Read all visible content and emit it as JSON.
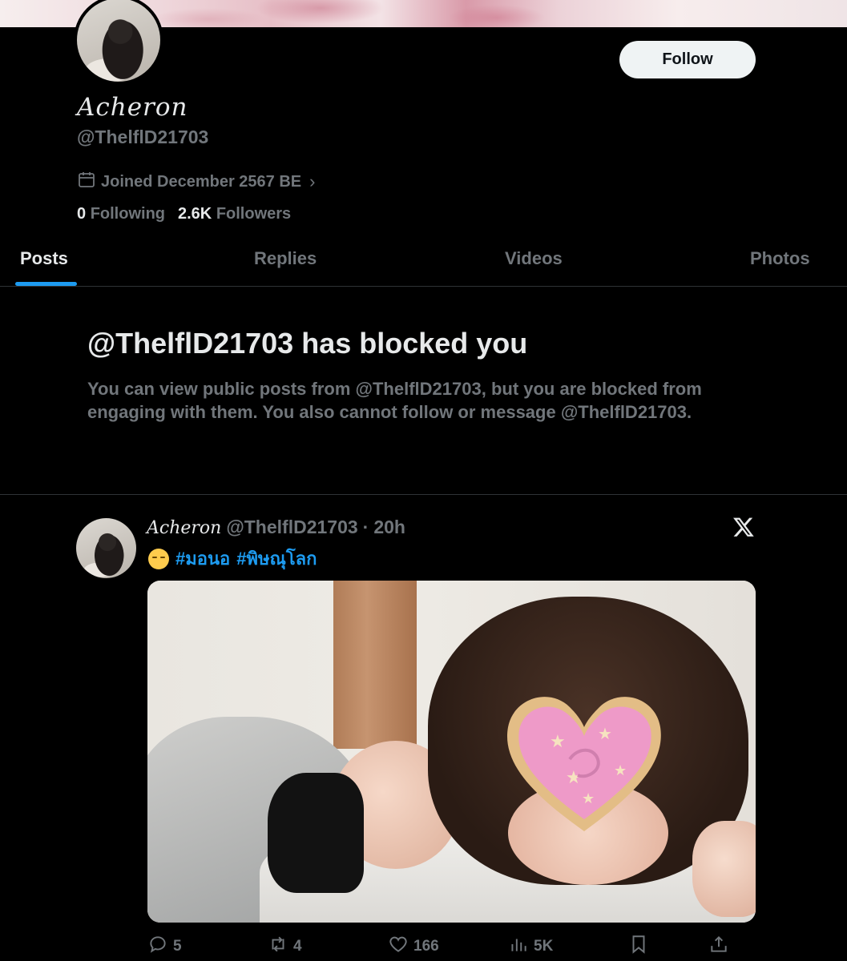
{
  "profile": {
    "display_name": "Acheron",
    "handle": "@ThelflD21703",
    "joined": "Joined December 2567 BE",
    "following_count": "0",
    "following_label": "Following",
    "followers_count": "2.6K",
    "followers_label": "Followers",
    "follow_label": "Follow"
  },
  "tabs": [
    {
      "label": "Posts",
      "active": true
    },
    {
      "label": "Replies",
      "active": false
    },
    {
      "label": "Videos",
      "active": false
    },
    {
      "label": "Photos",
      "active": false
    }
  ],
  "blocked": {
    "title": "@ThelflD21703 has blocked you",
    "message": "You can view public posts from @ThelflD21703, but you are blocked from engaging with them. You also cannot follow or message @ThelflD21703."
  },
  "post": {
    "author_name": "Acheron",
    "author_handle": "@ThelflD21703",
    "separator": "·",
    "time": "20h",
    "emoji": "pensive-face-emoji",
    "hashtags": [
      "#มอนอ",
      "#พิษณุโลก"
    ],
    "replies": "5",
    "reposts": "4",
    "likes": "166",
    "views": "5K"
  },
  "icons": {
    "calendar": "calendar-icon",
    "chevron": "chevron-right-icon",
    "x_logo": "x-logo-icon",
    "reply": "reply-icon",
    "repost": "repost-icon",
    "like": "heart-icon",
    "views": "views-icon",
    "bookmark": "bookmark-icon",
    "share": "share-icon"
  },
  "colors": {
    "background": "#000000",
    "text": "#e7e9ea",
    "muted": "#71767b",
    "accent": "#1d9bf0",
    "border": "#2f3336",
    "follow_bg": "#eff3f4"
  }
}
